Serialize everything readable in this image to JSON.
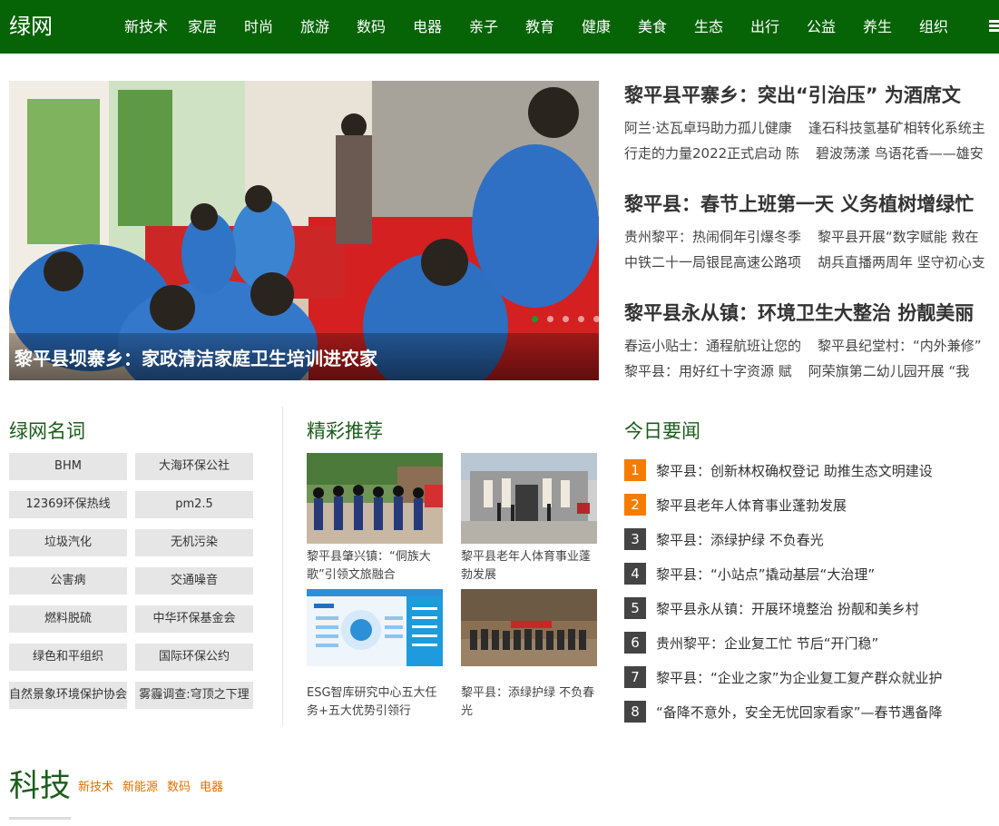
{
  "header": {
    "logo": "绿网",
    "nav": [
      "新技术",
      "家居",
      "时尚",
      "旅游",
      "数码",
      "电器",
      "亲子",
      "教育",
      "健康",
      "美食",
      "生态",
      "出行",
      "公益",
      "养生",
      "组织"
    ]
  },
  "slider": {
    "caption": "黎平县坝寨乡：家政清洁家庭卫生培训进农家",
    "slide_count": 5,
    "active_index": 0
  },
  "headlines": [
    {
      "title": "黎平县平寨乡：突出“引治压” 为酒席文",
      "lines": [
        [
          "阿兰·达瓦卓玛助力孤儿健康",
          "逢石科技氢基矿相转化系统主"
        ],
        [
          "行走的力量2022正式启动 陈",
          "碧波荡漾 鸟语花香——雄安"
        ]
      ]
    },
    {
      "title": "黎平县：春节上班第一天 义务植树增绿忙",
      "lines": [
        [
          "贵州黎平：热闹侗年引爆冬季",
          "黎平县开展“数字赋能 救在"
        ],
        [
          "中铁二十一局银昆高速公路项",
          "胡兵直播两周年 坚守初心支"
        ]
      ]
    },
    {
      "title": "黎平县永从镇：环境卫生大整治 扮靓美丽",
      "lines": [
        [
          "春运小贴士：通程航班让您的",
          "黎平县纪堂村：“内外兼修”"
        ],
        [
          "黎平县：用好红十字资源 赋",
          "阿荣旗第二幼儿园开展 “我"
        ]
      ]
    }
  ],
  "glossary": {
    "title": "绿网名词",
    "tags": [
      "BHM",
      "大海环保公社",
      "12369环保热线",
      "pm2.5",
      "垃圾汽化",
      "无机污染",
      "公害病",
      "交通噪音",
      "燃料脱硫",
      "中华环保基金会",
      "绿色和平组织",
      "国际环保公约",
      "自然景象环境保护协会",
      "雾霾调查:穹顶之下理"
    ]
  },
  "recommend": {
    "title": "精彩推荐",
    "items": [
      {
        "caption": "黎平县肇兴镇：“侗族大歌”引领文旅融合"
      },
      {
        "caption": "黎平县老年人体育事业蓬勃发展"
      },
      {
        "caption": "ESG智库研究中心五大任务+五大优势引领行"
      },
      {
        "caption": "黎平县：添绿护绿 不负春光"
      }
    ]
  },
  "news": {
    "title": "今日要闻",
    "items": [
      {
        "num": "1",
        "text": "黎平县：创新林权确权登记 助推生态文明建设"
      },
      {
        "num": "2",
        "text": "黎平县老年人体育事业蓬勃发展"
      },
      {
        "num": "3",
        "text": "黎平县：添绿护绿 不负春光"
      },
      {
        "num": "4",
        "text": "黎平县：“小站点”撬动基层“大治理”"
      },
      {
        "num": "5",
        "text": "黎平县永从镇：开展环境整治 扮靓和美乡村"
      },
      {
        "num": "6",
        "text": "贵州黎平：企业复工忙 节后“开门稳”"
      },
      {
        "num": "7",
        "text": "黎平县：“企业之家”为企业复工复产群众就业护"
      },
      {
        "num": "8",
        "text": "“备降不意外，安全无忧回家看家”—春节遇备降"
      }
    ]
  },
  "tech": {
    "title": "科技",
    "links": [
      "新技术",
      "新能源",
      "数码",
      "电器"
    ]
  },
  "colors": {
    "brand_green": "#066306",
    "hot_orange": "#f57c00",
    "link_orange": "#e07000"
  }
}
